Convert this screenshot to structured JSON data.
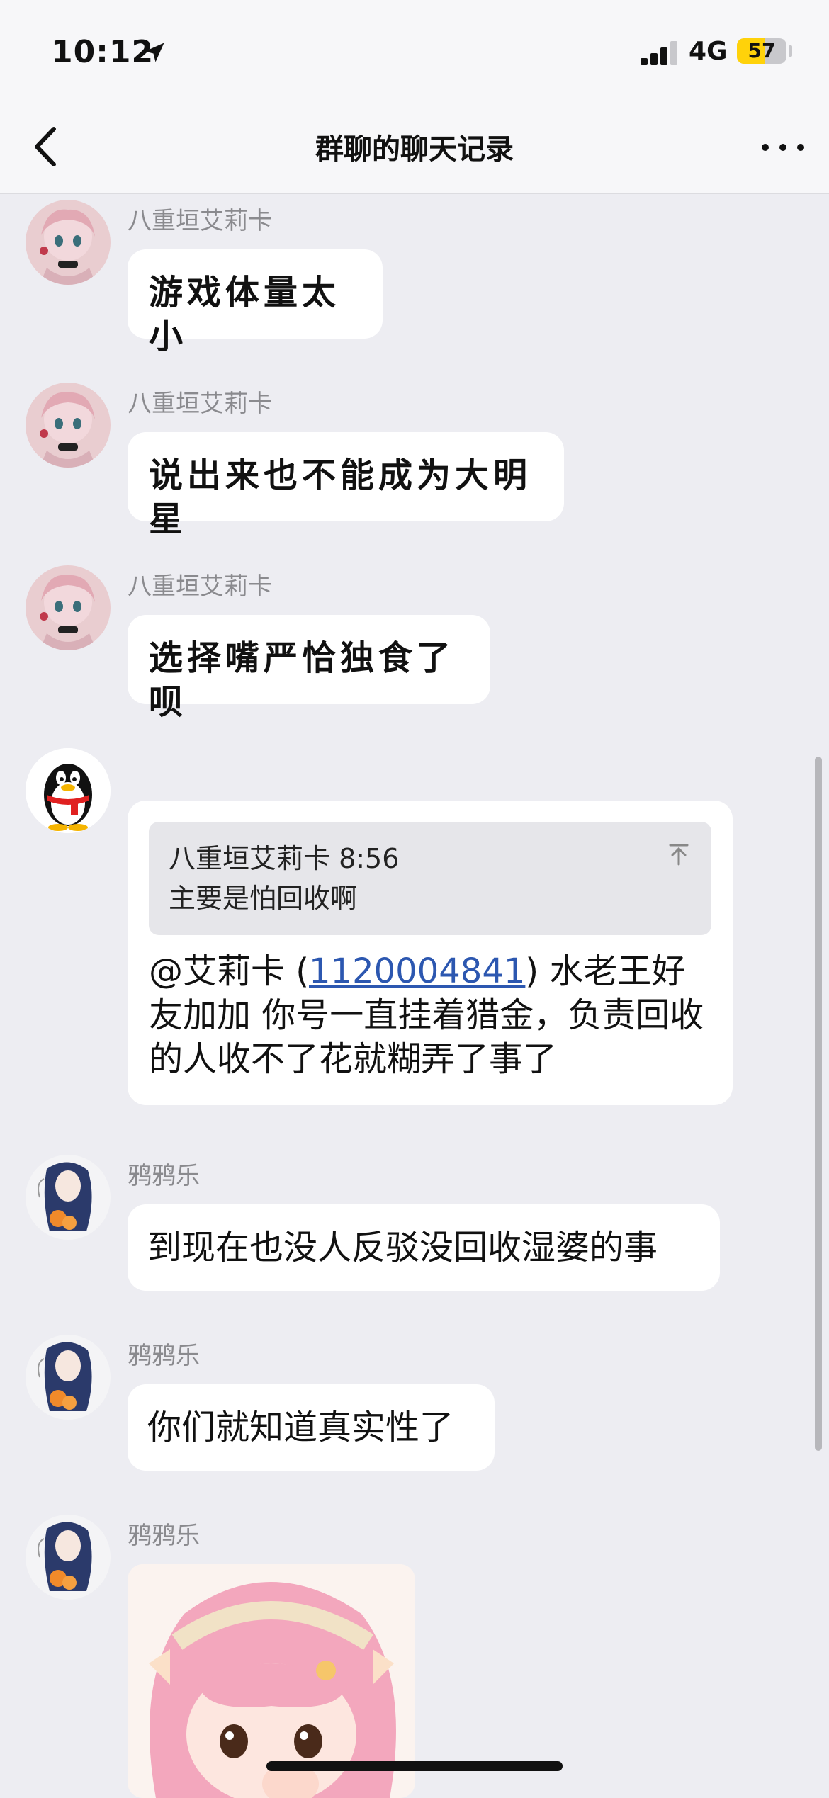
{
  "status_bar": {
    "time": "10:12",
    "network": "4G",
    "battery": "57",
    "battery_level": 0.57
  },
  "nav": {
    "title": "群聊的聊天记录",
    "back_icon": "chevron-left-icon",
    "more_icon": "more-dots-icon"
  },
  "messages": [
    {
      "sender": "八重垣艾莉卡",
      "text": "游戏体量太小"
    },
    {
      "sender": "八重垣艾莉卡",
      "text": "说出来也不能成为大明星"
    },
    {
      "sender": "八重垣艾莉卡",
      "text": "选择嘴严恰独食了呗"
    },
    {
      "sender": "",
      "quote_header": "八重垣艾莉卡 8:56",
      "quote_text": "主要是怕回收啊",
      "text_before": "@艾莉卡 (",
      "link": "1120004841",
      "text_after": ") 水老王好友加加 你号一直挂着猎金，负责回收的人收不了花就糊弄了事了"
    },
    {
      "sender": "鸦鸦乐",
      "text": "到现在也没人反驳没回收湿婆的事"
    },
    {
      "sender": "鸦鸦乐",
      "text": "你们就知道真实性了"
    },
    {
      "sender": "鸦鸦乐",
      "image": "sticker-image"
    }
  ],
  "colors": {
    "background": "#ededf2",
    "bubble": "#ffffff",
    "link": "#2c57b0",
    "battery": "#ffd20a"
  }
}
